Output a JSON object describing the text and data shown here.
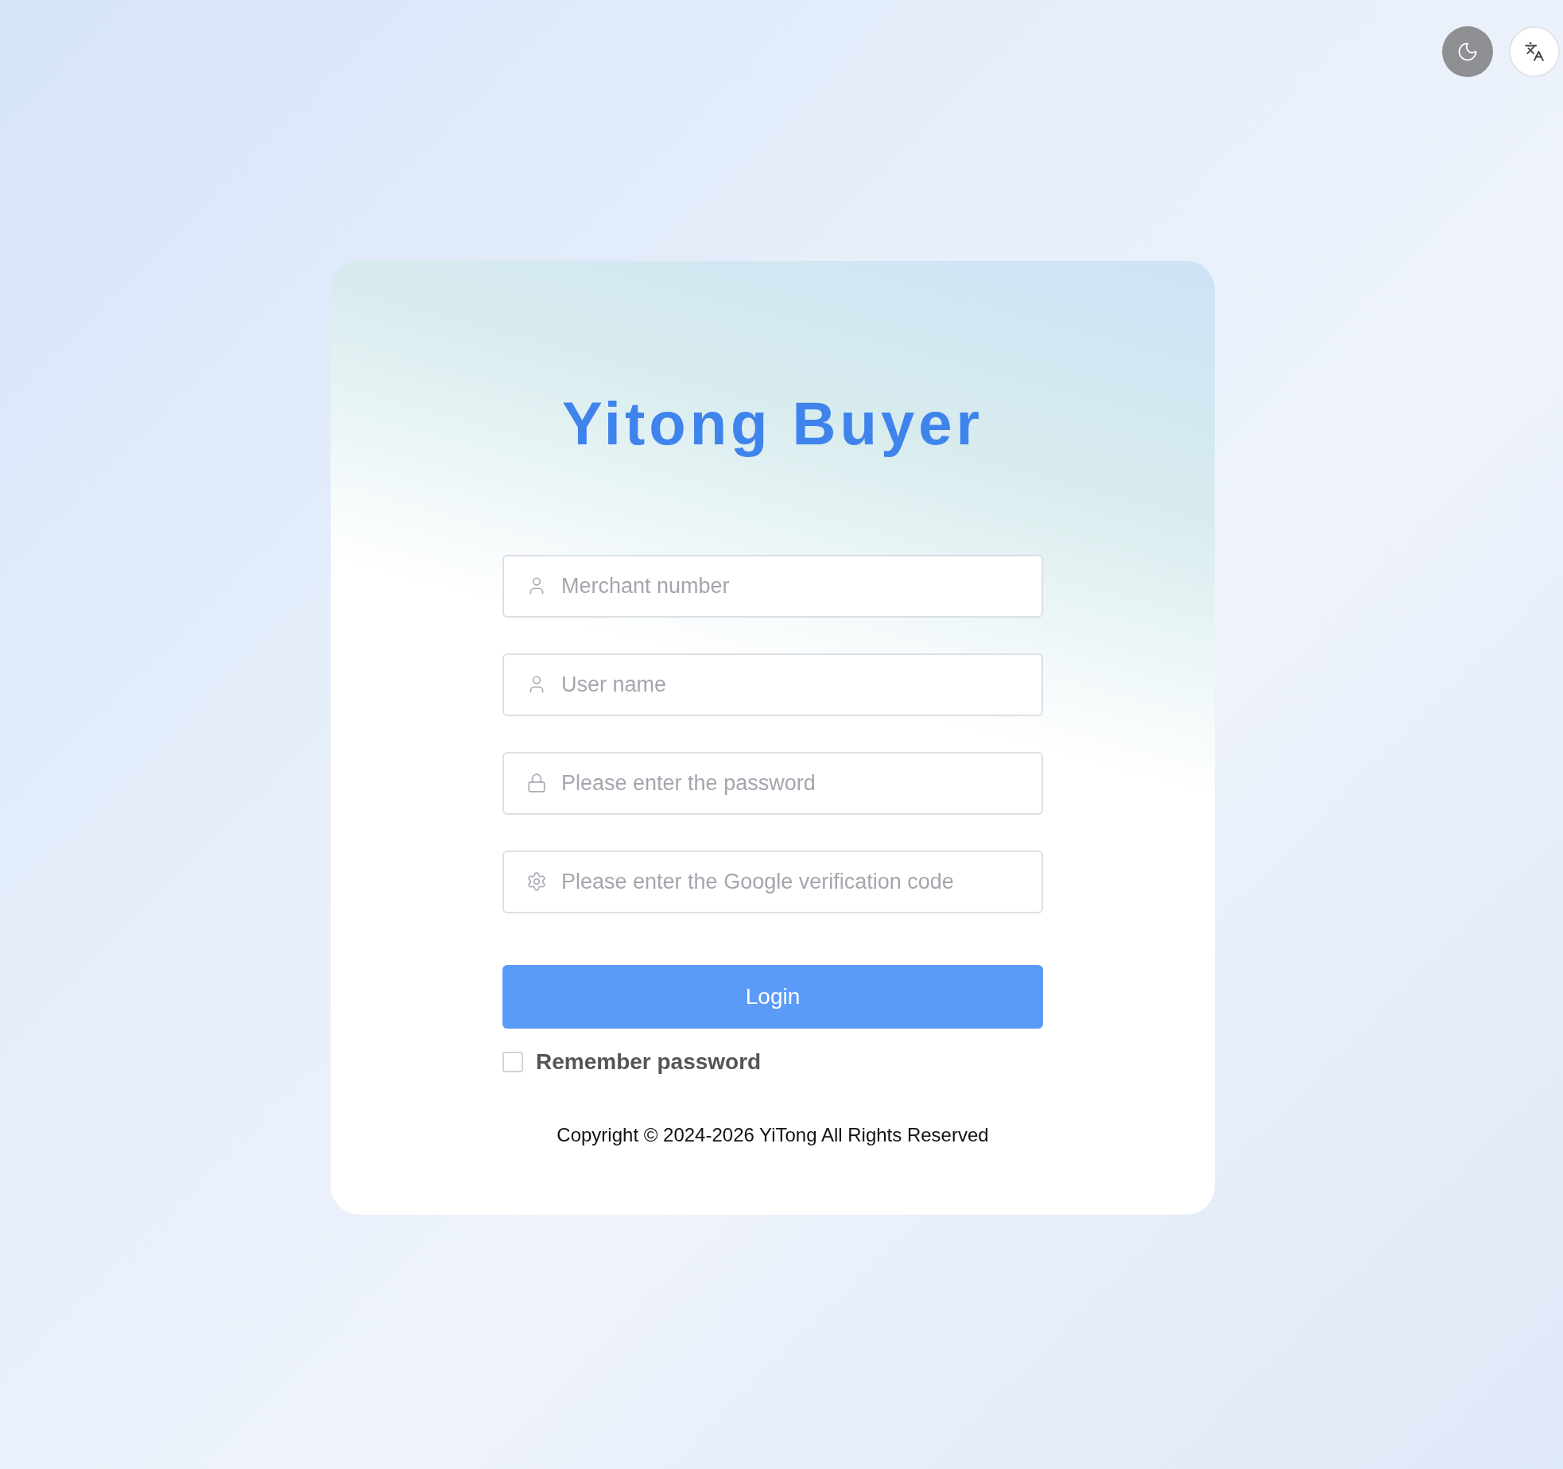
{
  "top_actions": [
    {
      "kind": "theme"
    },
    {
      "kind": "language"
    }
  ],
  "card": {
    "title": "Yitong Buyer",
    "fields": [
      {
        "kind": "person",
        "placeholder": "Merchant number"
      },
      {
        "kind": "person",
        "placeholder": "User name"
      },
      {
        "kind": "lock",
        "placeholder": "Please enter the password"
      },
      {
        "kind": "gear",
        "placeholder": "Please enter the Google verification code"
      }
    ],
    "login_button": "Login",
    "remember": {
      "label": "Remember password",
      "checked": false
    },
    "copyright": "Copyright © 2024-2026 YiTong All Rights Reserved"
  }
}
